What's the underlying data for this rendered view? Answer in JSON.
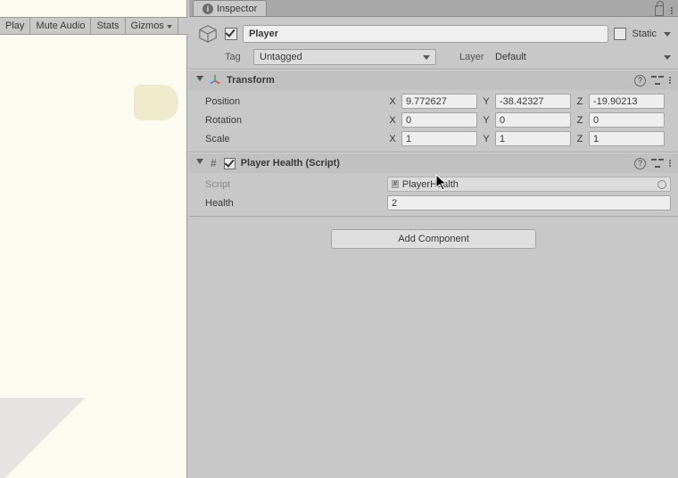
{
  "left": {
    "toolbar": [
      "Play",
      "Mute Audio",
      "Stats",
      "Gizmos"
    ]
  },
  "inspector": {
    "tab_label": "Inspector",
    "object_name": "Player",
    "static_label": "Static",
    "tag_label": "Tag",
    "tag_value": "Untagged",
    "layer_label": "Layer",
    "layer_value": "Default"
  },
  "transform": {
    "title": "Transform",
    "rows": {
      "position": {
        "label": "Position",
        "x": "9.772627",
        "y": "-38.42327",
        "z": "-19.90213"
      },
      "rotation": {
        "label": "Rotation",
        "x": "0",
        "y": "0",
        "z": "0"
      },
      "scale": {
        "label": "Scale",
        "x": "1",
        "y": "1",
        "z": "1"
      }
    },
    "axis": {
      "x": "X",
      "y": "Y",
      "z": "Z"
    }
  },
  "player_health": {
    "title": "Player Health (Script)",
    "script_label": "Script",
    "script_value": "PlayerHealth",
    "health_label": "Health",
    "health_value": "2"
  },
  "add_component": "Add Component"
}
